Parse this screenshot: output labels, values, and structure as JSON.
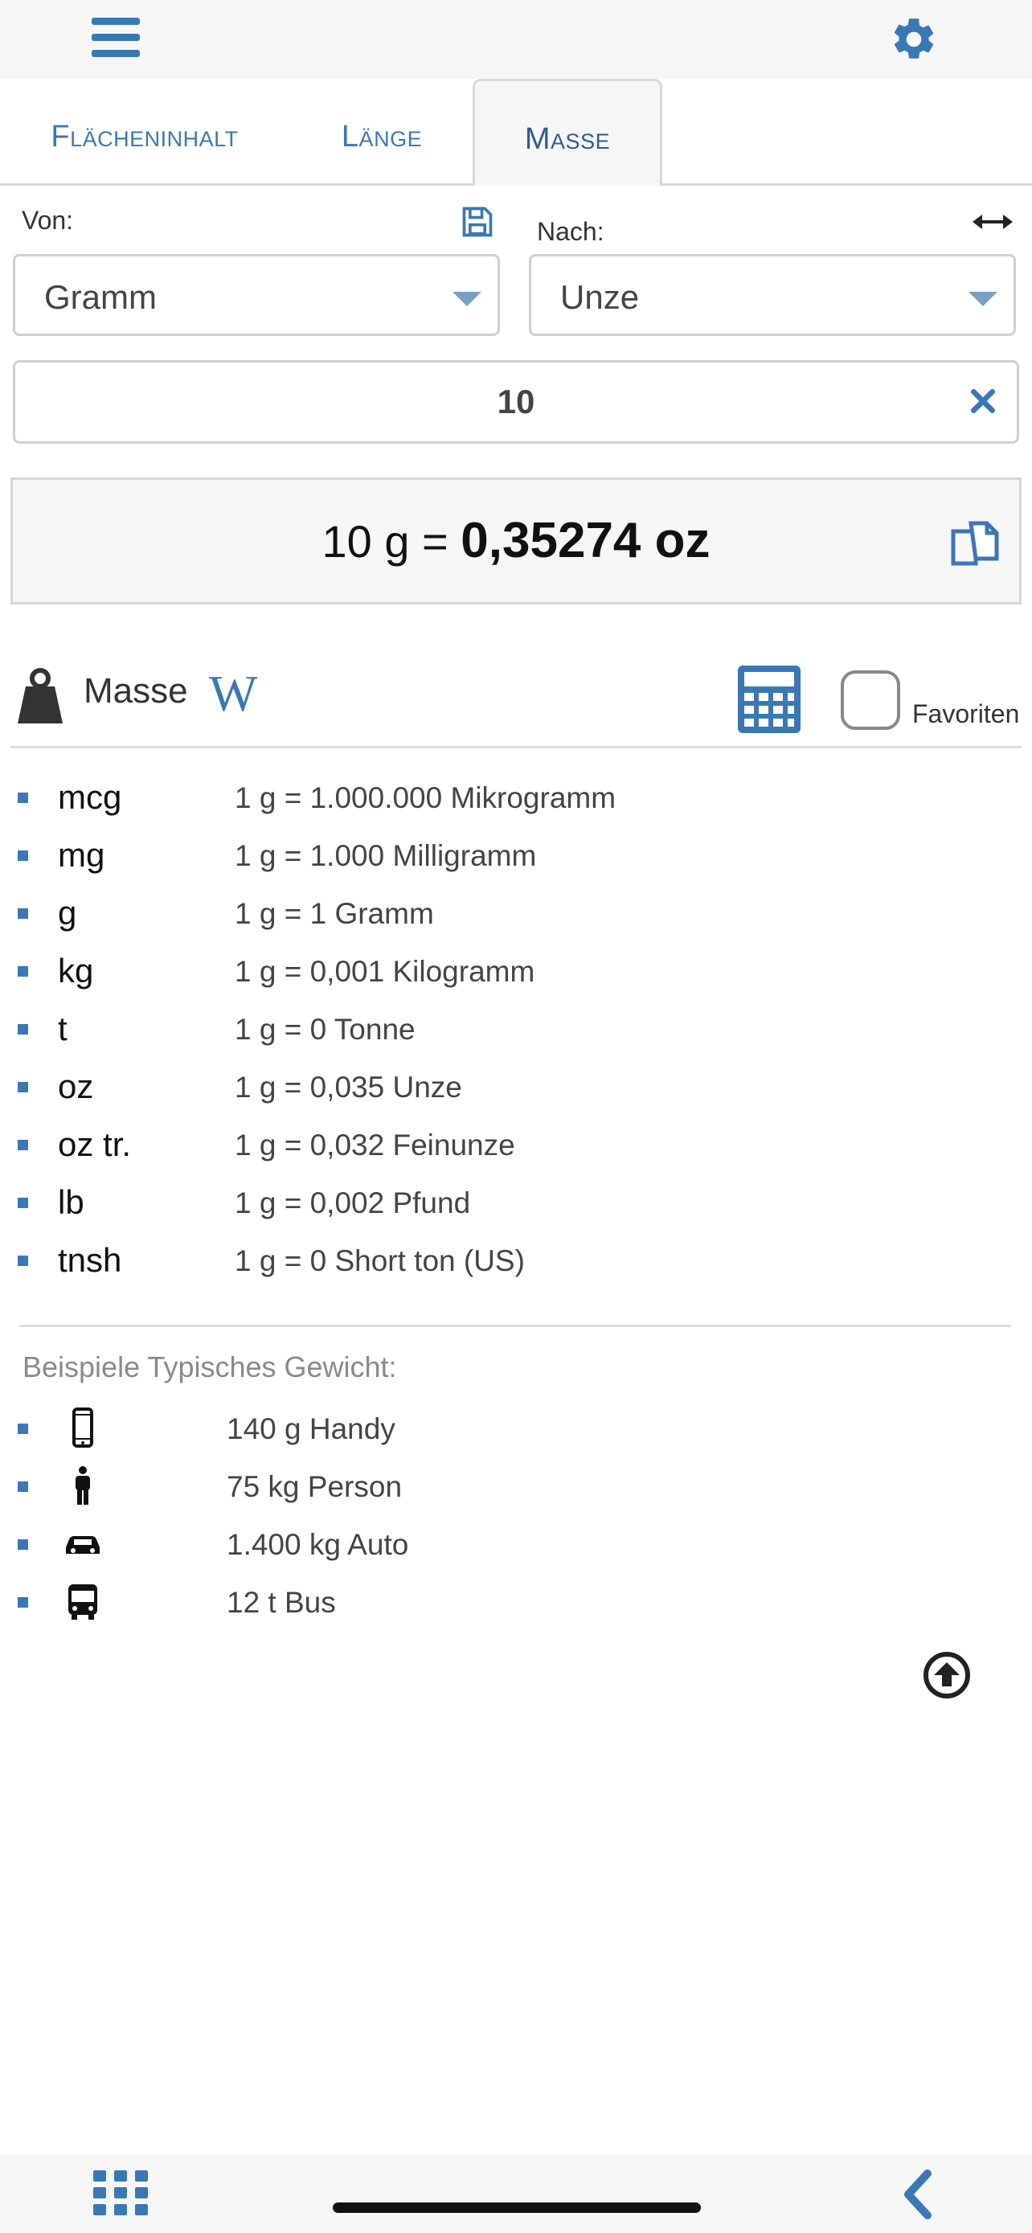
{
  "tabs": [
    {
      "label": "Flächeninhalt",
      "active": false
    },
    {
      "label": "Länge",
      "active": false
    },
    {
      "label": "Masse",
      "active": true
    }
  ],
  "from": {
    "label": "Von:",
    "value": "Gramm"
  },
  "to": {
    "label": "Nach:",
    "value": "Unze"
  },
  "input": {
    "value": "10"
  },
  "result": {
    "prefix": "10 g = ",
    "value": "0,35274 oz"
  },
  "section": {
    "title": "Masse",
    "wiki": "W",
    "favorites_label": "Favoriten",
    "favorite_checked": false
  },
  "conversions": [
    {
      "unit": "mcg",
      "text": "1 g = 1.000.000 Mikrogramm"
    },
    {
      "unit": "mg",
      "text": "1 g = 1.000 Milligramm"
    },
    {
      "unit": "g",
      "text": "1 g = 1 Gramm"
    },
    {
      "unit": "kg",
      "text": "1 g = 0,001 Kilogramm"
    },
    {
      "unit": "t",
      "text": "1 g = 0 Tonne"
    },
    {
      "unit": "oz",
      "text": "1 g = 0,035 Unze"
    },
    {
      "unit": "oz tr.",
      "text": "1 g = 0,032 Feinunze"
    },
    {
      "unit": "lb",
      "text": "1 g = 0,002 Pfund"
    },
    {
      "unit": "tnsh",
      "text": "1 g = 0 Short ton (US)"
    }
  ],
  "examples": {
    "title": "Beispiele Typisches Gewicht:",
    "items": [
      {
        "icon": "phone-icon",
        "text": "140 g Handy"
      },
      {
        "icon": "person-icon",
        "text": "75 kg Person"
      },
      {
        "icon": "car-icon",
        "text": "1.400 kg Auto"
      },
      {
        "icon": "bus-icon",
        "text": "12 t Bus"
      }
    ]
  },
  "colors": {
    "accent": "#3a78b5",
    "bar_bg": "#f6f6f6"
  }
}
